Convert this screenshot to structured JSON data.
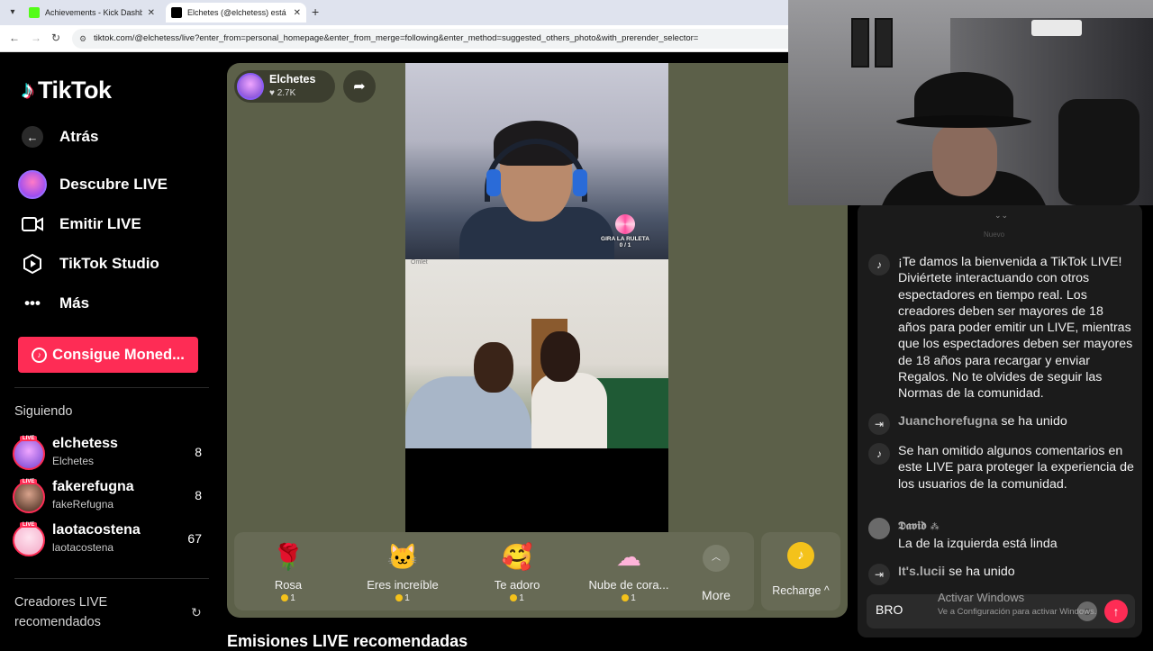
{
  "browser": {
    "tabs": [
      {
        "title": "Achievements - Kick Dashboard",
        "active": false
      },
      {
        "title": "Elchetes (@elchetess) está en LIVE",
        "active": true
      }
    ],
    "url": "tiktok.com/@elchetess/live?enter_from=personal_homepage&enter_from_merge=following&enter_method=suggested_others_photo&with_prerender_selector="
  },
  "sidebar": {
    "logo": "TikTok",
    "nav": [
      {
        "label": "Atrás",
        "icon": "back-arrow-icon"
      },
      {
        "label": "Descubre LIVE",
        "icon": "discover-live-icon"
      },
      {
        "label": "Emitir LIVE",
        "icon": "video-camera-icon"
      },
      {
        "label": "TikTok Studio",
        "icon": "studio-icon"
      },
      {
        "label": "Más",
        "icon": "more-dots-icon"
      }
    ],
    "coins_button": "Consigue Moned...",
    "following_title": "Siguiendo",
    "following": [
      {
        "name": "elchetess",
        "sub": "Elchetes",
        "count": "8",
        "live": "LIVE"
      },
      {
        "name": "fakerefugna",
        "sub": "fakeRefugna",
        "count": "8",
        "live": "LIVE"
      },
      {
        "name": "laotacostena",
        "sub": "laotacostena",
        "count": "67",
        "live": "LIVE"
      }
    ],
    "recommended_title": "Creadores LIVE recomendados"
  },
  "stream": {
    "host_name": "Elchetes",
    "host_likes": "♥ 2.7K",
    "overlay_roulette": "GIRA LA RULETA",
    "overlay_count": "0 / 1",
    "overlay_watermark": "Omlet"
  },
  "gifts": [
    {
      "name": "Rosa",
      "price": "1",
      "icon": "🌹"
    },
    {
      "name": "Eres increíble",
      "price": "1",
      "icon": "🐱"
    },
    {
      "name": "Te adoro",
      "price": "1",
      "icon": "🥰"
    },
    {
      "name": "Nube de cora...",
      "price": "1",
      "icon": "☁"
    }
  ],
  "more_label": "More",
  "recharge_label": "Recharge",
  "section_heading": "Emisiones LIVE recomendadas",
  "chat": {
    "new_label": "Nuevo",
    "welcome": "¡Te damos la bienvenida a TikTok LIVE! Diviértete interactuando con otros espectadores en tiempo real. Los creadores deben ser mayores de 18 años para poder emitir un LIVE, mientras que los espectadores deben ser mayores de 18 años para recargar y enviar Regalos. No te olvides de seguir las Normas de la comunidad.",
    "join1_user": "Juanchorefugna",
    "join1_text": "se ha unido",
    "omitted": "Se han omitido algunos comentarios en este LIVE para proteger la experiencia de los usuarios de la comunidad.",
    "david_name": "𝕯𝖆𝖛𝖎𝖉",
    "david_msg": "La de la izquierda está linda",
    "join2_user": "It's.lucii",
    "join2_text": "se ha unido",
    "input_value": "BRO"
  },
  "windows_activation": {
    "title": "Activar Windows",
    "subtitle": "Ve a Configuración para activar Windows."
  }
}
